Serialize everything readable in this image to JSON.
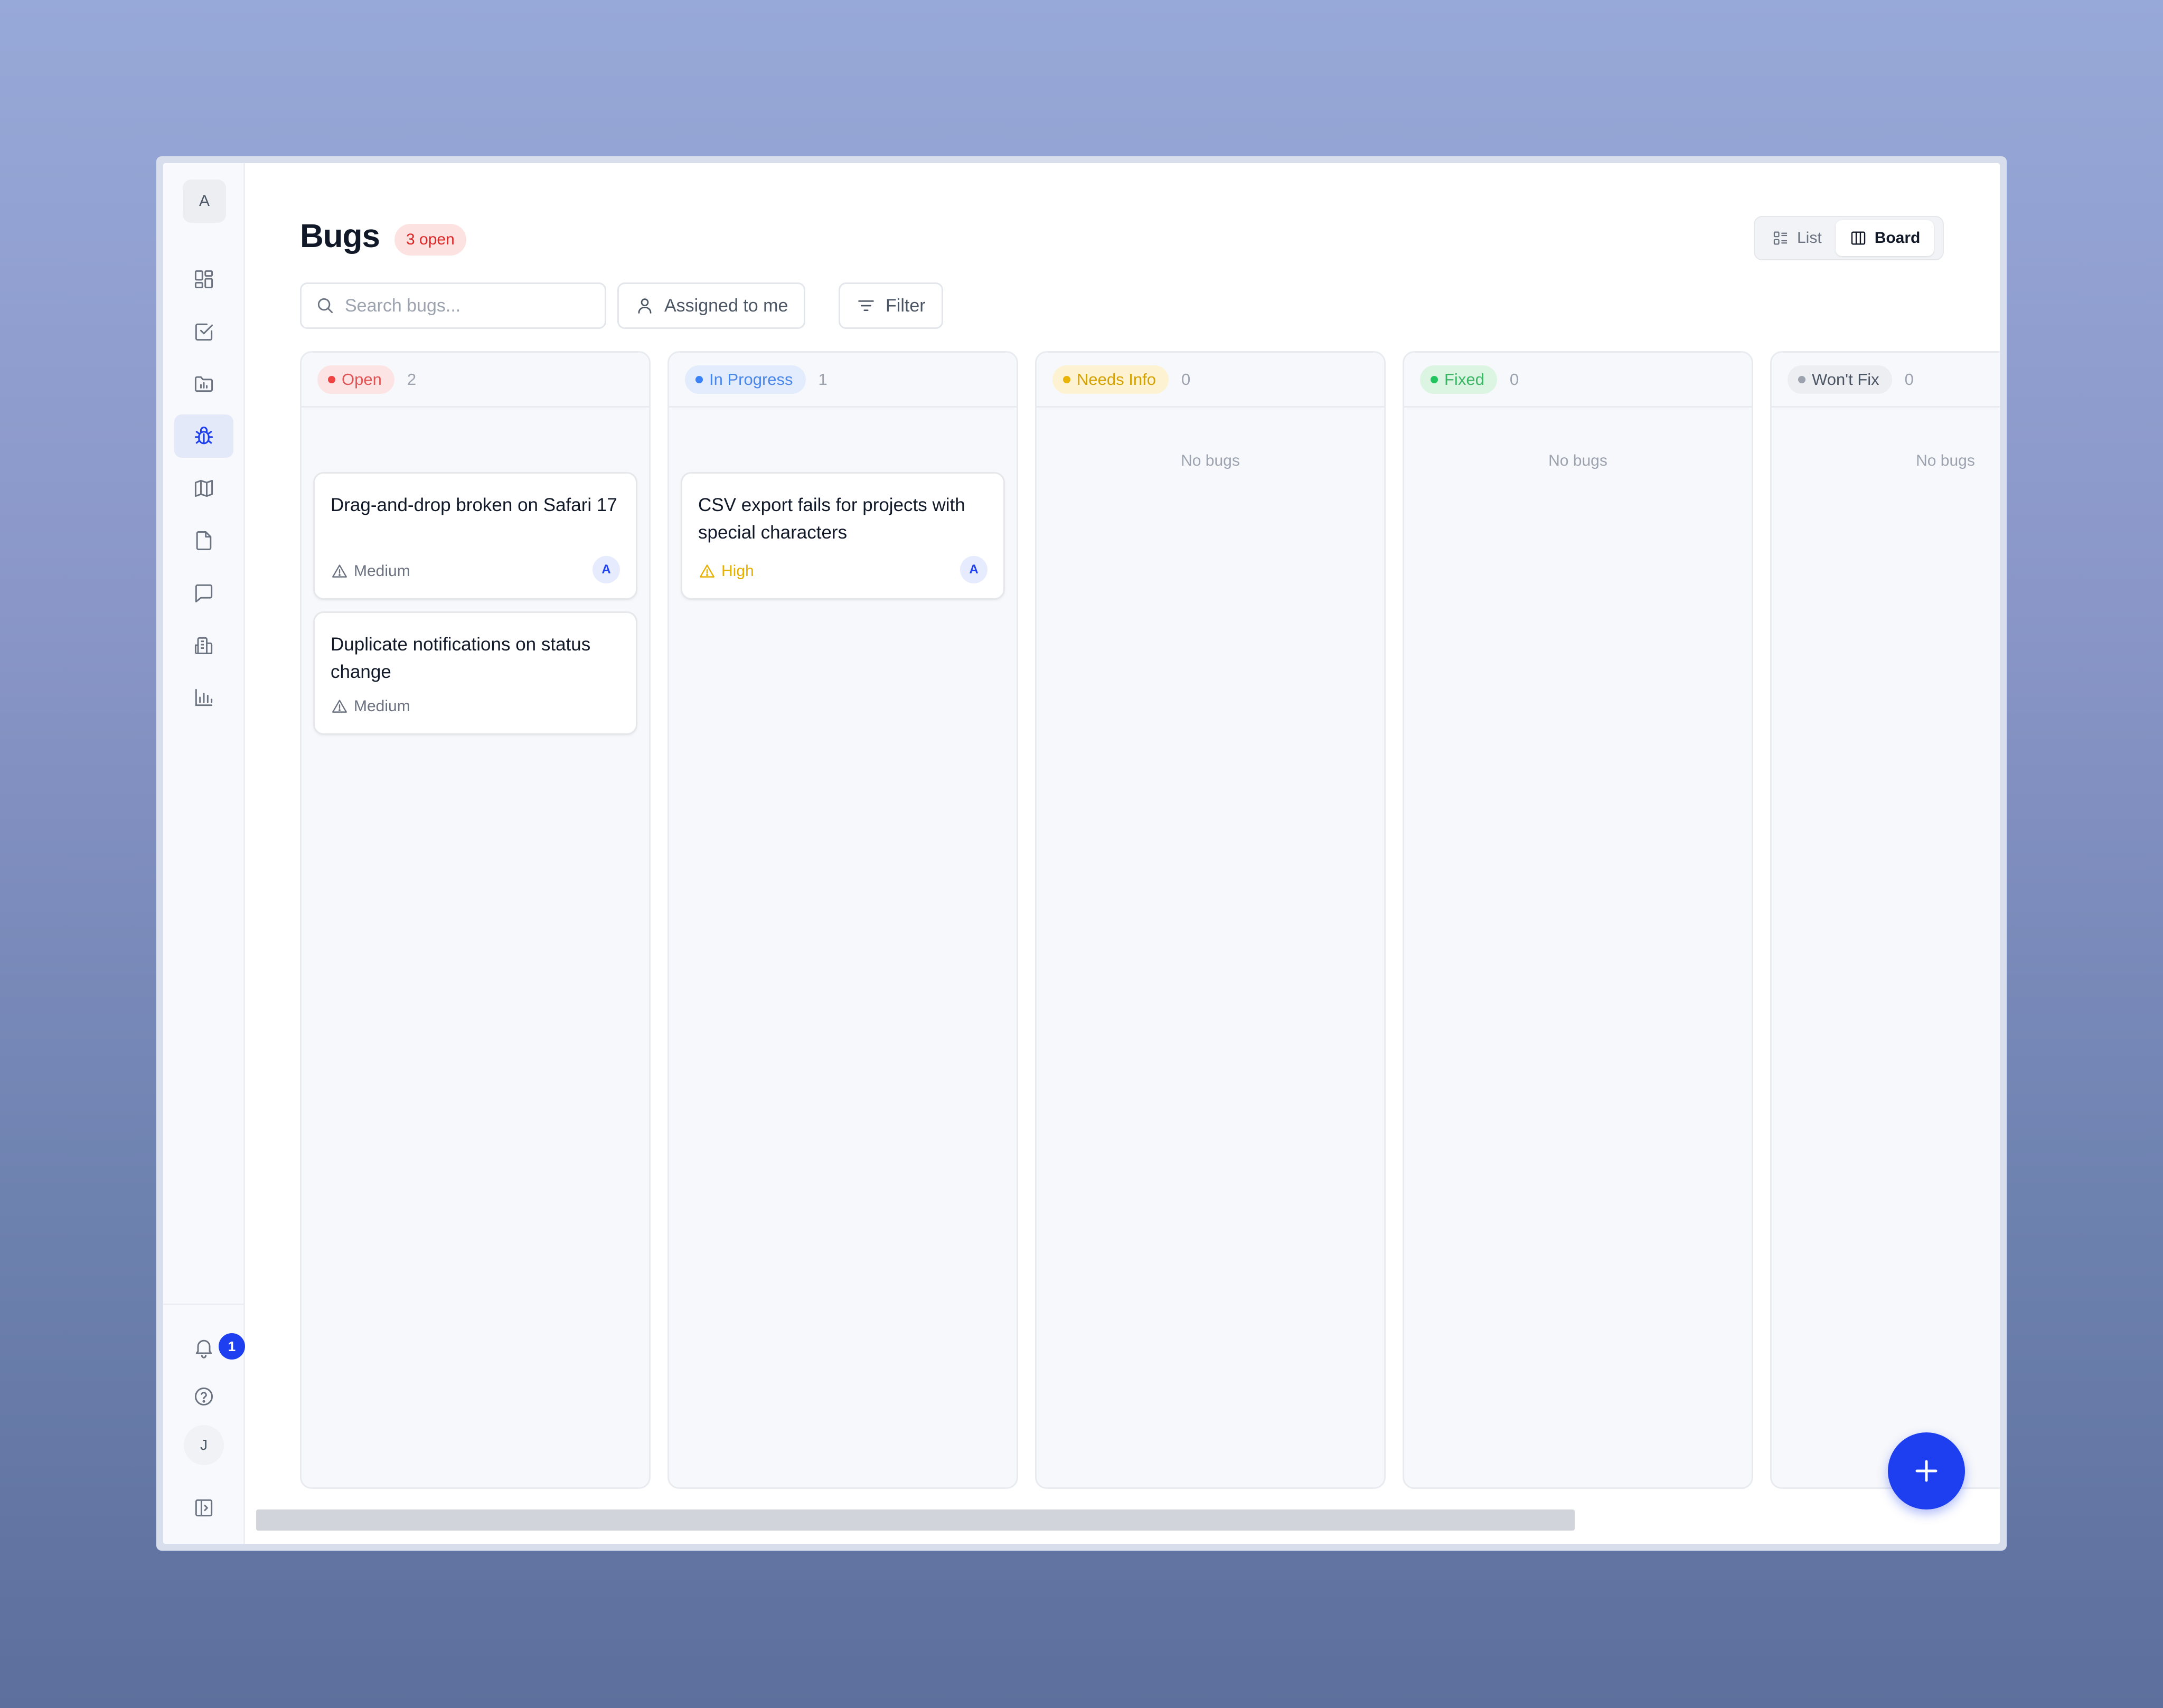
{
  "sidebar": {
    "workspace_initial": "A",
    "nav_items": [
      {
        "id": "dashboard",
        "icon": "dashboard-icon"
      },
      {
        "id": "tasks",
        "icon": "checkbox-icon"
      },
      {
        "id": "projects",
        "icon": "folder-chart-icon"
      },
      {
        "id": "bugs",
        "icon": "bug-icon",
        "active": true
      },
      {
        "id": "roadmap",
        "icon": "map-icon"
      },
      {
        "id": "docs",
        "icon": "document-icon"
      },
      {
        "id": "messages",
        "icon": "message-icon"
      },
      {
        "id": "companies",
        "icon": "building-icon"
      },
      {
        "id": "reports",
        "icon": "bar-chart-icon"
      }
    ],
    "notifications_count": "1",
    "user_initial": "J"
  },
  "header": {
    "title": "Bugs",
    "open_badge": "3 open",
    "view_toggle": {
      "list_label": "List",
      "board_label": "Board",
      "selected": "Board"
    }
  },
  "toolbar": {
    "search_placeholder": "Search bugs...",
    "assigned_label": "Assigned to me",
    "filter_label": "Filter"
  },
  "board": {
    "empty_text": "No bugs",
    "columns": [
      {
        "status": "Open",
        "count": "2",
        "color": "#ef4444",
        "bg": "#fde4e4",
        "text_color": "#e05555",
        "cards": [
          {
            "title": "Drag-and-drop broken on Safari 17",
            "priority": "Medium",
            "priority_color": "#6b7280",
            "assignee": "A"
          },
          {
            "title": "Duplicate notifications on status change",
            "priority": "Medium",
            "priority_color": "#6b7280",
            "assignee": ""
          }
        ]
      },
      {
        "status": "In Progress",
        "count": "1",
        "color": "#3b82f6",
        "bg": "#e2ecfc",
        "text_color": "#4a86e8",
        "cards": [
          {
            "title": "CSV export fails for projects with special characters",
            "priority": "High",
            "priority_color": "#e6b000",
            "assignee": "A"
          }
        ]
      },
      {
        "status": "Needs Info",
        "count": "0",
        "color": "#eab308",
        "bg": "#fdf3d2",
        "text_color": "#d4a106",
        "cards": []
      },
      {
        "status": "Fixed",
        "count": "0",
        "color": "#22c55e",
        "bg": "#dcf5e3",
        "text_color": "#3bb664",
        "cards": []
      },
      {
        "status": "Won't Fix",
        "count": "0",
        "color": "#9ca3af",
        "bg": "#eceef2",
        "text_color": "#4b5563",
        "cards": []
      }
    ]
  },
  "fab": {
    "icon": "plus-icon"
  },
  "accent_color": "#1d3ff0"
}
